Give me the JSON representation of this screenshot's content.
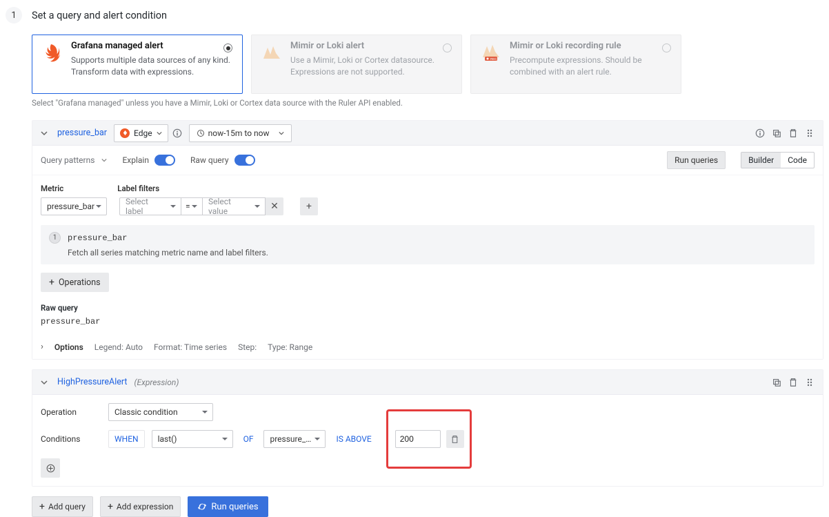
{
  "step": {
    "number": "1",
    "title": "Set a query and alert condition"
  },
  "cards": {
    "grafana": {
      "title": "Grafana managed alert",
      "desc": "Supports multiple data sources of any kind. Transform data with expressions."
    },
    "mimir_alert": {
      "title": "Mimir or Loki alert",
      "desc": "Use a Mimir, Loki or Cortex datasource. Expressions are not supported."
    },
    "mimir_rule": {
      "title": "Mimir or Loki recording rule",
      "desc": "Precompute expressions. Should be combined with an alert rule."
    }
  },
  "hint": "Select \"Grafana managed\" unless you have a Mimir, Loki or Cortex data source with the Ruler API enabled.",
  "queryPanel": {
    "name": "pressure_bar",
    "datasource": "Edge",
    "timerange": "now-15m to now",
    "patterns": "Query patterns",
    "explain_label": "Explain",
    "rawquery_label": "Raw query",
    "run_queries": "Run queries",
    "mode_builder": "Builder",
    "mode_code": "Code",
    "metric_label": "Metric",
    "labelfilters_label": "Label filters",
    "metric": "pressure_bar",
    "select_label_ph": "Select label",
    "eq": "=",
    "select_value_ph": "Select value",
    "explain_metric": "pressure_bar",
    "explain_text": "Fetch all series matching metric name and label filters.",
    "operations": "Operations",
    "rawq_label": "Raw query",
    "rawq_val": "pressure_bar",
    "options_label": "Options",
    "legend": "Legend: Auto",
    "format": "Format: Time series",
    "step": "Step:",
    "type": "Type: Range"
  },
  "exprPanel": {
    "name": "HighPressureAlert",
    "tag": "(Expression)",
    "op_label": "Operation",
    "op_value": "Classic condition",
    "cond_label": "Conditions",
    "when": "WHEN",
    "func": "last()",
    "of": "OF",
    "series": "pressure_…",
    "isabove": "IS ABOVE",
    "threshold": "200"
  },
  "footer": {
    "add_query": "Add query",
    "add_expression": "Add expression",
    "run_queries": "Run queries"
  }
}
